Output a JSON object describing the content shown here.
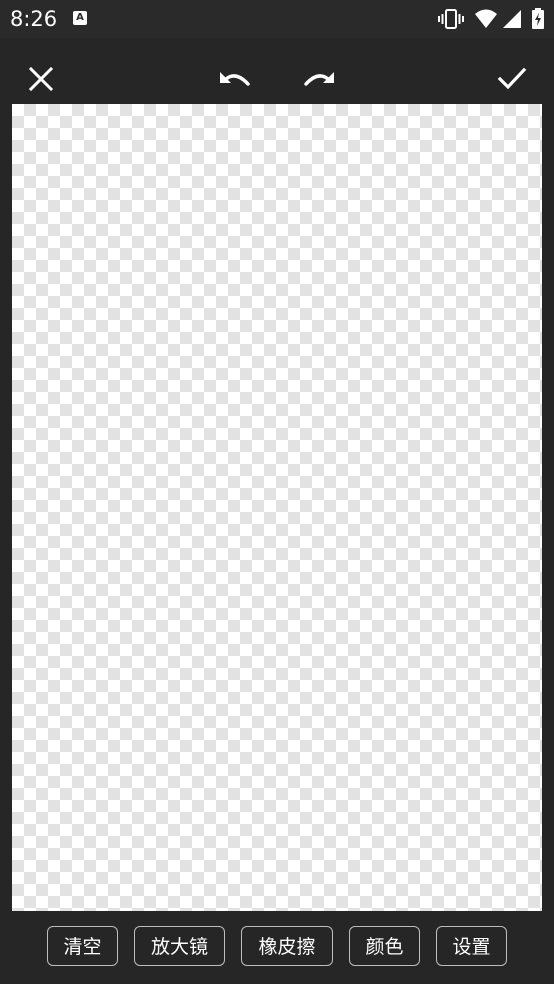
{
  "status_bar": {
    "time": "8:26",
    "notification_glyph": "A",
    "icons": [
      "vibrate-icon",
      "wifi-icon",
      "signal-icon",
      "battery-icon"
    ]
  },
  "toolbar": {
    "icons": [
      "close-icon",
      "undo-icon",
      "redo-icon",
      "check-icon"
    ]
  },
  "canvas": {
    "background": "transparent-checkerboard"
  },
  "bottom_bar": {
    "buttons": [
      {
        "label": "清空"
      },
      {
        "label": "放大镜"
      },
      {
        "label": "橡皮擦"
      },
      {
        "label": "颜色"
      },
      {
        "label": "设置"
      }
    ]
  },
  "colors": {
    "background": "#262626",
    "button_border": "#bdbdbd",
    "text": "#ffffff"
  }
}
